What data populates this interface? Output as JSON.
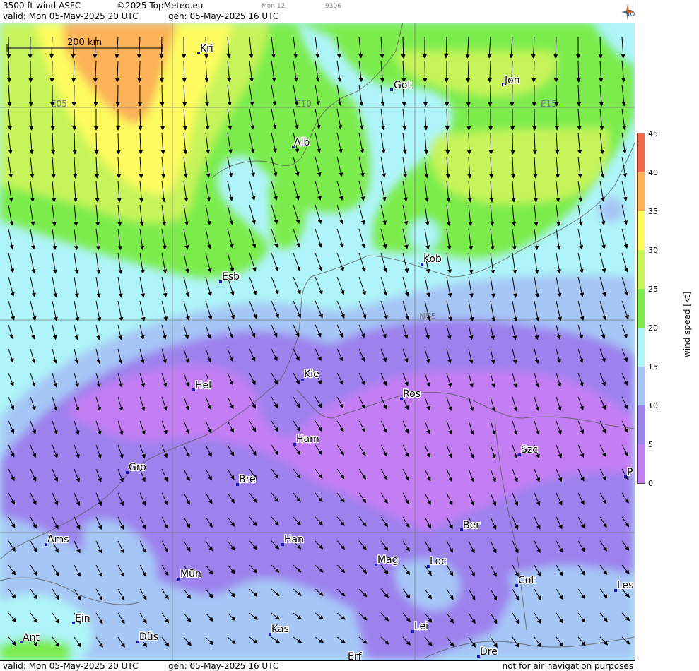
{
  "header": {
    "product": "3500 ft wind ASFC",
    "copyright": "©2025 TopMeteo.eu",
    "code_left": "Mon 12",
    "code_right": "9306",
    "valid": "valid:  Mon  05-May-2025  20 UTC",
    "gen": "gen: 05-May-2025 16 UTC",
    "brand": "TopMeteo"
  },
  "footer": {
    "valid": "valid:  Mon  05-May-2025  20 UTC",
    "gen": "gen: 05-May-2025 16 UTC",
    "disclaimer": "not for air navigation purposes"
  },
  "scale_bar": {
    "label": "200 km"
  },
  "grid_labels": [
    {
      "name": "E05",
      "label": "E05"
    },
    {
      "name": "E10",
      "label": "E10"
    },
    {
      "name": "E15",
      "label": "E15"
    },
    {
      "name": "N55",
      "label": "N55"
    }
  ],
  "cities": [
    {
      "id": "kri",
      "label": "Kri"
    },
    {
      "id": "got",
      "label": "Got"
    },
    {
      "id": "jon",
      "label": "Jon"
    },
    {
      "id": "alb",
      "label": "Alb"
    },
    {
      "id": "kob",
      "label": "Kob"
    },
    {
      "id": "esb",
      "label": "Esb"
    },
    {
      "id": "kie",
      "label": "Kie"
    },
    {
      "id": "hel",
      "label": "Hel"
    },
    {
      "id": "ros",
      "label": "Ros"
    },
    {
      "id": "ham",
      "label": "Ham"
    },
    {
      "id": "szc",
      "label": "Szc"
    },
    {
      "id": "gro",
      "label": "Gro"
    },
    {
      "id": "bre",
      "label": "Bre"
    },
    {
      "id": "p",
      "label": "P"
    },
    {
      "id": "ber",
      "label": "Ber"
    },
    {
      "id": "ams",
      "label": "Ams"
    },
    {
      "id": "han",
      "label": "Han"
    },
    {
      "id": "mag",
      "label": "Mag"
    },
    {
      "id": "loc",
      "label": "Loc"
    },
    {
      "id": "mun",
      "label": "Mün"
    },
    {
      "id": "cot",
      "label": "Cot"
    },
    {
      "id": "les",
      "label": "Les"
    },
    {
      "id": "ein",
      "label": "Ein"
    },
    {
      "id": "lei",
      "label": "Lei"
    },
    {
      "id": "kas",
      "label": "Kas"
    },
    {
      "id": "ant",
      "label": "Ant"
    },
    {
      "id": "dus",
      "label": "Düs"
    },
    {
      "id": "erf",
      "label": "Erf"
    },
    {
      "id": "dre",
      "label": "Dre"
    }
  ],
  "legend": {
    "unit_label": "wind speed [kt]",
    "ticks": [
      "45",
      "40",
      "35",
      "30",
      "25",
      "20",
      "15",
      "10",
      "5",
      "0"
    ],
    "colors": {
      "c0_5": "#c47ef4",
      "c5_10": "#9d82ee",
      "c10_15": "#a6c6f6",
      "c15_20": "#aef4f8",
      "c20_25": "#7cec4e",
      "c25_30": "#c6f45a",
      "c30_35": "#fdfb5e",
      "c35_40": "#fbb258",
      "c40_45": "#ee6a4a"
    }
  }
}
